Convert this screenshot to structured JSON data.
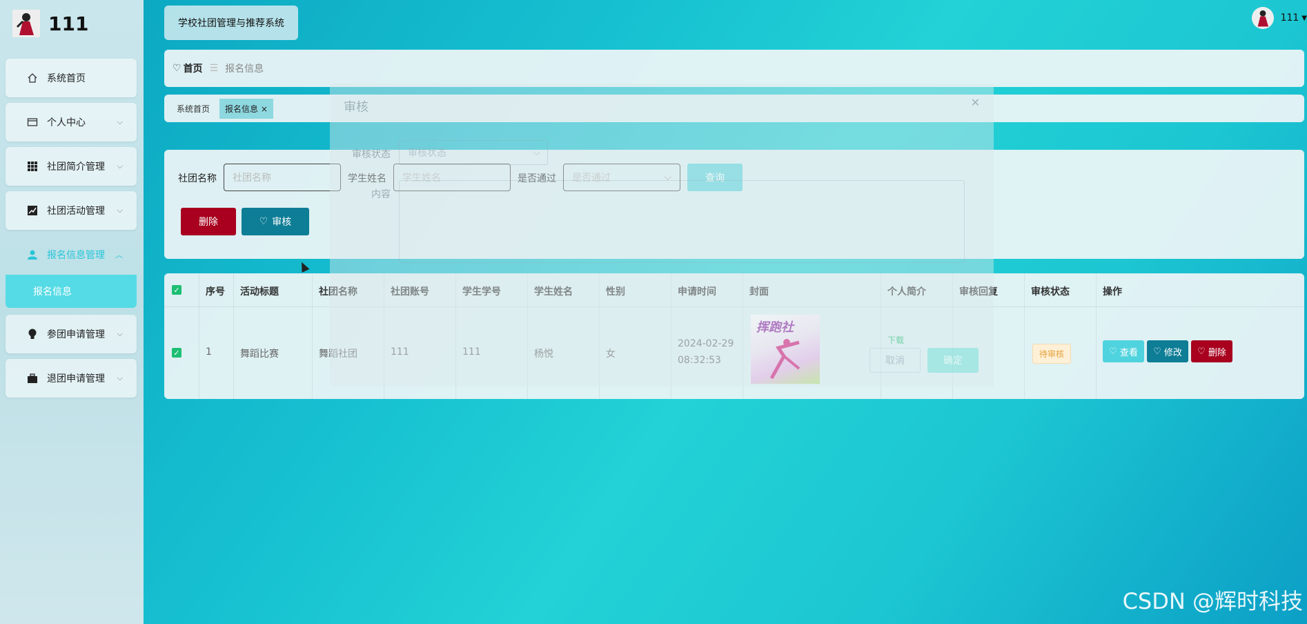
{
  "brand": {
    "name": "111"
  },
  "sidebar": {
    "items": [
      {
        "label": "系统首页",
        "icon": "home-icon"
      },
      {
        "label": "个人中心",
        "icon": "card-icon"
      },
      {
        "label": "社团简介管理",
        "icon": "grid-icon"
      },
      {
        "label": "社团活动管理",
        "icon": "chart-icon"
      },
      {
        "label": "报名信息管理",
        "icon": "user-icon"
      },
      {
        "label": "参团申请管理",
        "icon": "bulb-icon"
      },
      {
        "label": "退团申请管理",
        "icon": "briefcase-icon"
      }
    ],
    "submenu": {
      "label": "报名信息"
    }
  },
  "header": {
    "system_title": "学校社团管理与推荐系统",
    "user": "111"
  },
  "breadcrumb": {
    "home": "首页",
    "current": "报名信息"
  },
  "tags": {
    "home": "系统首页",
    "active": "报名信息"
  },
  "search": {
    "club_label": "社团名称",
    "club_placeholder": "社团名称",
    "student_label": "学生姓名",
    "student_placeholder": "学生姓名",
    "passed_label": "是否通过",
    "passed_placeholder": "是否通过",
    "query_button": "查询",
    "delete_button": "删除",
    "review_button": "审核"
  },
  "table": {
    "headers": [
      "序号",
      "活动标题",
      "社团名称",
      "社团账号",
      "学生学号",
      "学生姓名",
      "性别",
      "申请时间",
      "封面",
      "个人简介",
      "审核回复",
      "审核状态",
      "操作"
    ],
    "row": {
      "index": "1",
      "title": "舞蹈比赛",
      "club": "舞蹈社团",
      "account": "111",
      "student_id": "111",
      "student_name": "杨悦",
      "gender": "女",
      "apply_date": "2024-02-29",
      "apply_time": "08:32:53",
      "cover_text": "挥跑社",
      "intro": "下载",
      "status": "待审核",
      "view_button": "查看",
      "edit_button": "修改",
      "delete_button": "删除"
    }
  },
  "modal": {
    "title": "审核",
    "status_label": "审核状态",
    "status_placeholder": "审核状态",
    "content_label": "内容",
    "cancel_button": "取消",
    "confirm_button": "确定"
  },
  "watermark": "CSDN @辉时科技",
  "colors": {
    "accent": "#27c5d8",
    "danger": "#a8001e",
    "primary": "#0e7d96",
    "success": "#1dbf73"
  }
}
